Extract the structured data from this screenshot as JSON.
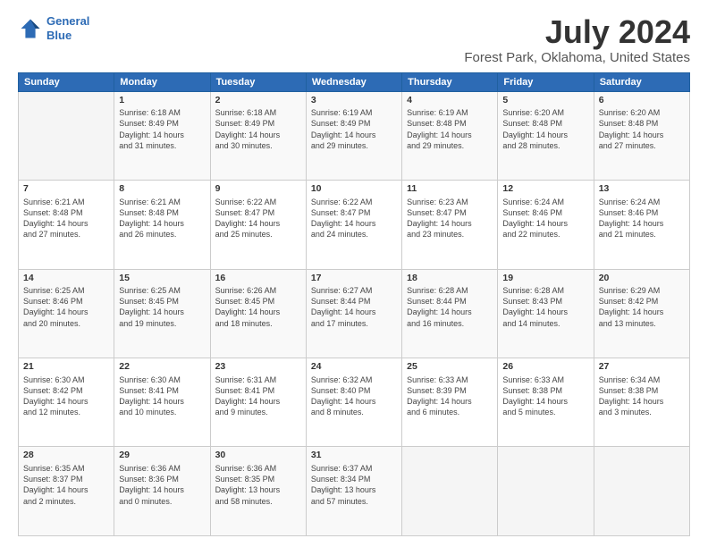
{
  "logo": {
    "line1": "General",
    "line2": "Blue"
  },
  "title": "July 2024",
  "subtitle": "Forest Park, Oklahoma, United States",
  "header_days": [
    "Sunday",
    "Monday",
    "Tuesday",
    "Wednesday",
    "Thursday",
    "Friday",
    "Saturday"
  ],
  "weeks": [
    [
      {
        "day": "",
        "content": ""
      },
      {
        "day": "1",
        "content": "Sunrise: 6:18 AM\nSunset: 8:49 PM\nDaylight: 14 hours\nand 31 minutes."
      },
      {
        "day": "2",
        "content": "Sunrise: 6:18 AM\nSunset: 8:49 PM\nDaylight: 14 hours\nand 30 minutes."
      },
      {
        "day": "3",
        "content": "Sunrise: 6:19 AM\nSunset: 8:49 PM\nDaylight: 14 hours\nand 29 minutes."
      },
      {
        "day": "4",
        "content": "Sunrise: 6:19 AM\nSunset: 8:48 PM\nDaylight: 14 hours\nand 29 minutes."
      },
      {
        "day": "5",
        "content": "Sunrise: 6:20 AM\nSunset: 8:48 PM\nDaylight: 14 hours\nand 28 minutes."
      },
      {
        "day": "6",
        "content": "Sunrise: 6:20 AM\nSunset: 8:48 PM\nDaylight: 14 hours\nand 27 minutes."
      }
    ],
    [
      {
        "day": "7",
        "content": "Sunrise: 6:21 AM\nSunset: 8:48 PM\nDaylight: 14 hours\nand 27 minutes."
      },
      {
        "day": "8",
        "content": "Sunrise: 6:21 AM\nSunset: 8:48 PM\nDaylight: 14 hours\nand 26 minutes."
      },
      {
        "day": "9",
        "content": "Sunrise: 6:22 AM\nSunset: 8:47 PM\nDaylight: 14 hours\nand 25 minutes."
      },
      {
        "day": "10",
        "content": "Sunrise: 6:22 AM\nSunset: 8:47 PM\nDaylight: 14 hours\nand 24 minutes."
      },
      {
        "day": "11",
        "content": "Sunrise: 6:23 AM\nSunset: 8:47 PM\nDaylight: 14 hours\nand 23 minutes."
      },
      {
        "day": "12",
        "content": "Sunrise: 6:24 AM\nSunset: 8:46 PM\nDaylight: 14 hours\nand 22 minutes."
      },
      {
        "day": "13",
        "content": "Sunrise: 6:24 AM\nSunset: 8:46 PM\nDaylight: 14 hours\nand 21 minutes."
      }
    ],
    [
      {
        "day": "14",
        "content": "Sunrise: 6:25 AM\nSunset: 8:46 PM\nDaylight: 14 hours\nand 20 minutes."
      },
      {
        "day": "15",
        "content": "Sunrise: 6:25 AM\nSunset: 8:45 PM\nDaylight: 14 hours\nand 19 minutes."
      },
      {
        "day": "16",
        "content": "Sunrise: 6:26 AM\nSunset: 8:45 PM\nDaylight: 14 hours\nand 18 minutes."
      },
      {
        "day": "17",
        "content": "Sunrise: 6:27 AM\nSunset: 8:44 PM\nDaylight: 14 hours\nand 17 minutes."
      },
      {
        "day": "18",
        "content": "Sunrise: 6:28 AM\nSunset: 8:44 PM\nDaylight: 14 hours\nand 16 minutes."
      },
      {
        "day": "19",
        "content": "Sunrise: 6:28 AM\nSunset: 8:43 PM\nDaylight: 14 hours\nand 14 minutes."
      },
      {
        "day": "20",
        "content": "Sunrise: 6:29 AM\nSunset: 8:42 PM\nDaylight: 14 hours\nand 13 minutes."
      }
    ],
    [
      {
        "day": "21",
        "content": "Sunrise: 6:30 AM\nSunset: 8:42 PM\nDaylight: 14 hours\nand 12 minutes."
      },
      {
        "day": "22",
        "content": "Sunrise: 6:30 AM\nSunset: 8:41 PM\nDaylight: 14 hours\nand 10 minutes."
      },
      {
        "day": "23",
        "content": "Sunrise: 6:31 AM\nSunset: 8:41 PM\nDaylight: 14 hours\nand 9 minutes."
      },
      {
        "day": "24",
        "content": "Sunrise: 6:32 AM\nSunset: 8:40 PM\nDaylight: 14 hours\nand 8 minutes."
      },
      {
        "day": "25",
        "content": "Sunrise: 6:33 AM\nSunset: 8:39 PM\nDaylight: 14 hours\nand 6 minutes."
      },
      {
        "day": "26",
        "content": "Sunrise: 6:33 AM\nSunset: 8:38 PM\nDaylight: 14 hours\nand 5 minutes."
      },
      {
        "day": "27",
        "content": "Sunrise: 6:34 AM\nSunset: 8:38 PM\nDaylight: 14 hours\nand 3 minutes."
      }
    ],
    [
      {
        "day": "28",
        "content": "Sunrise: 6:35 AM\nSunset: 8:37 PM\nDaylight: 14 hours\nand 2 minutes."
      },
      {
        "day": "29",
        "content": "Sunrise: 6:36 AM\nSunset: 8:36 PM\nDaylight: 14 hours\nand 0 minutes."
      },
      {
        "day": "30",
        "content": "Sunrise: 6:36 AM\nSunset: 8:35 PM\nDaylight: 13 hours\nand 58 minutes."
      },
      {
        "day": "31",
        "content": "Sunrise: 6:37 AM\nSunset: 8:34 PM\nDaylight: 13 hours\nand 57 minutes."
      },
      {
        "day": "",
        "content": ""
      },
      {
        "day": "",
        "content": ""
      },
      {
        "day": "",
        "content": ""
      }
    ]
  ]
}
